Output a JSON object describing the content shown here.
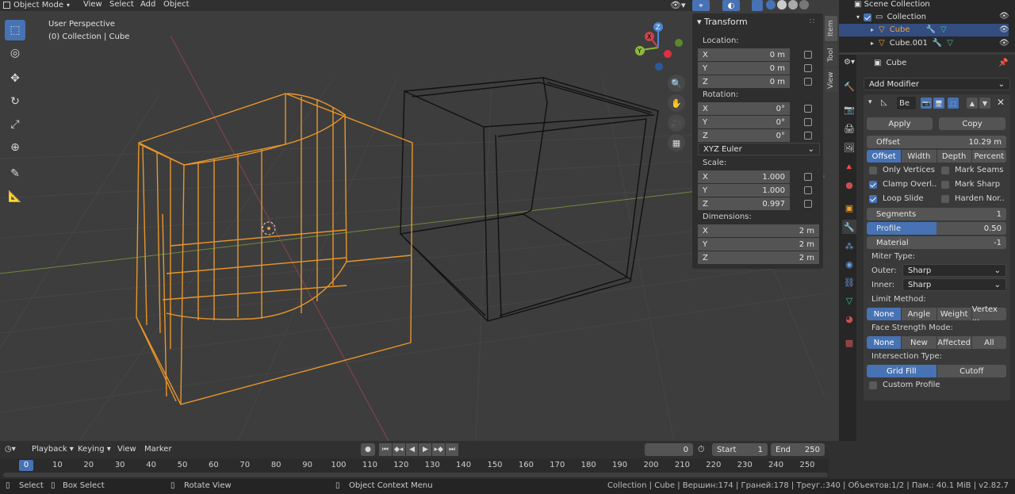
{
  "topbar": {
    "mode": "Object Mode",
    "menus": [
      "View",
      "Select",
      "Add",
      "Object"
    ]
  },
  "viewport": {
    "view_name": "User Perspective",
    "collection_info": "(0) Collection | Cube"
  },
  "transform": {
    "title": "Transform",
    "location_label": "Location:",
    "location": [
      {
        "axis": "X",
        "value": "0 m"
      },
      {
        "axis": "Y",
        "value": "0 m"
      },
      {
        "axis": "Z",
        "value": "0 m"
      }
    ],
    "rotation_label": "Rotation:",
    "rotation": [
      {
        "axis": "X",
        "value": "0°"
      },
      {
        "axis": "Y",
        "value": "0°"
      },
      {
        "axis": "Z",
        "value": "0°"
      }
    ],
    "rotation_mode": "XYZ Euler",
    "scale_label": "Scale:",
    "scale": [
      {
        "axis": "X",
        "value": "1.000"
      },
      {
        "axis": "Y",
        "value": "1.000"
      },
      {
        "axis": "Z",
        "value": "0.997"
      }
    ],
    "dimensions_label": "Dimensions:",
    "dimensions": [
      {
        "axis": "X",
        "value": "2 m"
      },
      {
        "axis": "Y",
        "value": "2 m"
      },
      {
        "axis": "Z",
        "value": "2 m"
      }
    ]
  },
  "side_tabs": [
    "Item",
    "Tool",
    "View"
  ],
  "gizmo": {
    "x": "X",
    "y": "Y",
    "z": "Z"
  },
  "outliner": {
    "title": "Scene Collection",
    "collection": "Collection",
    "items": [
      "Cube",
      "Cube.001"
    ]
  },
  "properties": {
    "object_name": "Cube",
    "add_modifier": "Add Modifier",
    "modifier_name": "Be",
    "apply": "Apply",
    "copy": "Copy",
    "offset_label": "Offset",
    "offset_value": "10.29 m",
    "width_types": [
      "Offset",
      "Width",
      "Depth",
      "Percent"
    ],
    "checks": [
      {
        "label": "Only Vertices",
        "on": false
      },
      {
        "label": "Mark Seams",
        "on": false
      },
      {
        "label": "Clamp Overl..",
        "on": true
      },
      {
        "label": "Mark Sharp",
        "on": false
      },
      {
        "label": "Loop Slide",
        "on": true
      },
      {
        "label": "Harden Nor..",
        "on": false
      }
    ],
    "segments_label": "Segments",
    "segments_value": "1",
    "profile_label": "Profile",
    "profile_value": "0.50",
    "profile_fraction": 0.5,
    "material_label": "Material",
    "material_value": "-1",
    "miter_label": "Miter Type:",
    "outer_label": "Outer:",
    "outer_value": "Sharp",
    "inner_label": "Inner:",
    "inner_value": "Sharp",
    "limit_label": "Limit Method:",
    "limit_options": [
      "None",
      "Angle",
      "Weight",
      "Vertex ..."
    ],
    "face_label": "Face Strength Mode:",
    "face_options": [
      "None",
      "New",
      "Affected",
      "All"
    ],
    "intersection_label": "Intersection Type:",
    "intersection_options": [
      "Grid Fill",
      "Cutoff"
    ],
    "custom_profile": "Custom Profile"
  },
  "timeline": {
    "menus": [
      "Playback",
      "Keying",
      "View",
      "Marker"
    ],
    "current_frame": "0",
    "start_label": "Start",
    "start_value": "1",
    "end_label": "End",
    "end_value": "250",
    "ticks": [
      "0",
      "10",
      "20",
      "30",
      "40",
      "50",
      "60",
      "70",
      "80",
      "90",
      "100",
      "110",
      "120",
      "130",
      "140",
      "150",
      "160",
      "170",
      "180",
      "190",
      "200",
      "210",
      "220",
      "230",
      "240",
      "250"
    ]
  },
  "statusbar": {
    "select": "Select",
    "box_select": "Box Select",
    "rotate_view": "Rotate View",
    "context_menu": "Object Context Menu",
    "stats": "Collection | Cube | Вершин:174 | Граней:178 | Треуг.:340 | Объектов:1/2 | Пам.: 40.1 MiB | v2.82.7"
  },
  "colors": {
    "accent": "#4772b3",
    "selected": "#f0a030",
    "axis_x": "#c8444e",
    "axis_y": "#8db83a",
    "axis_z": "#4a86d8"
  }
}
